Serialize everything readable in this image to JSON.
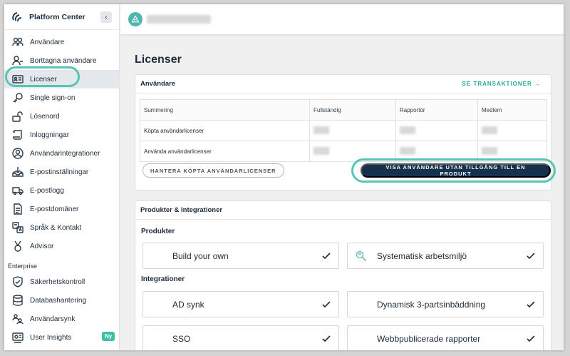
{
  "sidebar": {
    "brand": "Platform Center",
    "items": [
      {
        "label": "Användare",
        "icon": "users-icon",
        "active": false
      },
      {
        "label": "Borttagna användare",
        "icon": "user-minus-icon",
        "active": false
      },
      {
        "label": "Licenser",
        "icon": "id-card-icon",
        "active": true
      },
      {
        "label": "Single sign-on",
        "icon": "key-icon",
        "active": false
      },
      {
        "label": "Lösenord",
        "icon": "unlock-icon",
        "active": false
      },
      {
        "label": "Inloggningar",
        "icon": "scroll-icon",
        "active": false
      },
      {
        "label": "Användarintegrationer",
        "icon": "user-circle-icon",
        "active": false
      },
      {
        "label": "E-postinställningar",
        "icon": "inbox-download-icon",
        "active": false
      },
      {
        "label": "E-postlogg",
        "icon": "truck-icon",
        "active": false
      },
      {
        "label": "E-postdomäner",
        "icon": "document-icon",
        "active": false
      },
      {
        "label": "Språk & Kontakt",
        "icon": "translate-icon",
        "active": false
      },
      {
        "label": "Advisor",
        "icon": "medal-icon",
        "active": false
      }
    ],
    "enterprise_label": "Enterprise",
    "enterprise_items": [
      {
        "label": "Säkerhetskontroll",
        "icon": "shield-check-icon"
      },
      {
        "label": "Databashantering",
        "icon": "database-icon"
      },
      {
        "label": "Användarsynk",
        "icon": "user-sync-icon"
      },
      {
        "label": "User Insights",
        "icon": "insights-icon",
        "badge": "Ny"
      }
    ]
  },
  "main": {
    "title": "Licenser",
    "users_card": {
      "title": "Användare",
      "link": "SE TRANSAKTIONER →",
      "columns": [
        "Summering",
        "Fullständig",
        "Rapportör",
        "Medlem"
      ],
      "rows": [
        {
          "label": "Köpta användarlicenser"
        },
        {
          "label": "Använda användarlicenser"
        }
      ],
      "manage_button": "HANTERA KÖPTA ANVÄNDARLICENSER",
      "show_button": "VISA ANVÄNDARE UTAN TILLGÅNG TILL EN PRODUKT"
    },
    "products_card": {
      "title": "Produkter & Integrationer",
      "products_heading": "Produkter",
      "products": [
        {
          "label": "Build your own",
          "icon": "",
          "checked": true
        },
        {
          "label": "Systematisk arbetsmiljö",
          "icon": "search-person-icon",
          "checked": true
        }
      ],
      "integrations_heading": "Integrationer",
      "integrations": [
        {
          "label": "AD synk",
          "checked": true
        },
        {
          "label": "Dynamisk 3-partsinbäddning",
          "checked": true
        },
        {
          "label": "SSO",
          "checked": true
        },
        {
          "label": "Webbpublicerade rapporter",
          "checked": true
        }
      ]
    }
  },
  "colors": {
    "accent": "#2aa89a",
    "highlight": "#56c5b5",
    "primary_button": "#15314d",
    "badge": "#3cbfa5"
  }
}
